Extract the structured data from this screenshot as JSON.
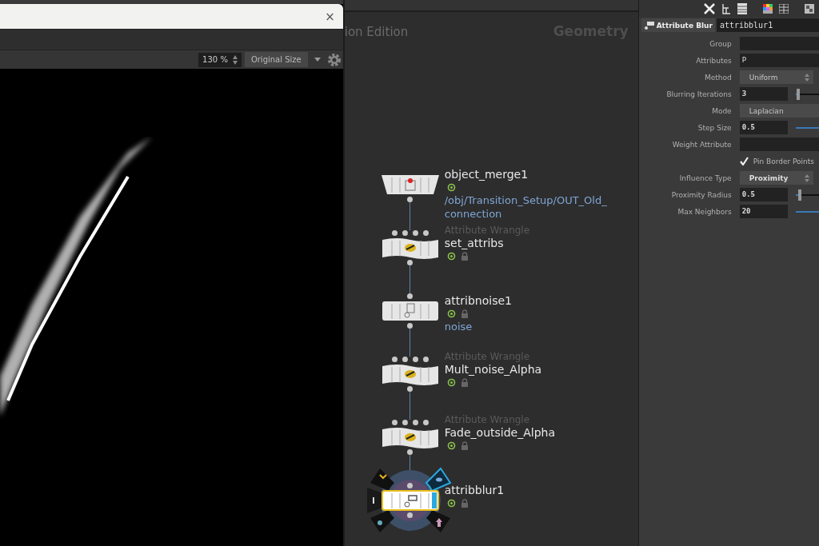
{
  "viewer": {
    "close": "×",
    "zoom": "130 %",
    "size_mode": "Original Size"
  },
  "network": {
    "watermark": "ion Edition",
    "context": "Geometry",
    "nodes": [
      {
        "kind": "merge",
        "name": "object_merge1",
        "path": "/obj/Transition_Setup/OUT_Old_connection",
        "lock_icon": false,
        "selected": false
      },
      {
        "kind": "wrangle",
        "type_label": "Attribute Wrangle",
        "name": "set_attribs",
        "lock_icon": true,
        "selected": false
      },
      {
        "kind": "noise",
        "name": "attribnoise1",
        "path": "noise",
        "lock_icon": true,
        "selected": false
      },
      {
        "kind": "wrangle",
        "type_label": "Attribute Wrangle",
        "name": "Mult_noise_Alpha",
        "lock_icon": true,
        "selected": false
      },
      {
        "kind": "wrangle",
        "type_label": "Attribute Wrangle",
        "name": "Fade_outside_Alpha",
        "lock_icon": true,
        "selected": false
      },
      {
        "kind": "blur",
        "name": "attribblur1",
        "lock_icon": true,
        "selected": true
      }
    ]
  },
  "parameters": {
    "node_type": "Attribute Blur",
    "node_name": "attribblur1",
    "rows": [
      {
        "kind": "text",
        "label": "Group"
      },
      {
        "kind": "text",
        "label": "Attributes",
        "value": "P"
      },
      {
        "kind": "menu",
        "label": "Method",
        "value": "Uniform"
      },
      {
        "kind": "slider",
        "label": "Blurring Iterations",
        "value": "3",
        "level": 0.05
      },
      {
        "kind": "button",
        "label": "Mode",
        "value": "Laplacian"
      },
      {
        "kind": "slider",
        "label": "Step Size",
        "value": "0.5",
        "level": 1
      },
      {
        "kind": "text",
        "label": "Weight Attribute"
      },
      {
        "kind": "checkbox",
        "label": "Pin Border Points",
        "checked": true
      },
      {
        "kind": "menu",
        "label": "Influence Type",
        "value": "Proximity"
      },
      {
        "kind": "slider",
        "label": "Proximity Radius",
        "value": "0.5",
        "level": 0.1
      },
      {
        "kind": "slider",
        "label": "Max Neighbors",
        "value": "20",
        "level": 1
      }
    ]
  }
}
